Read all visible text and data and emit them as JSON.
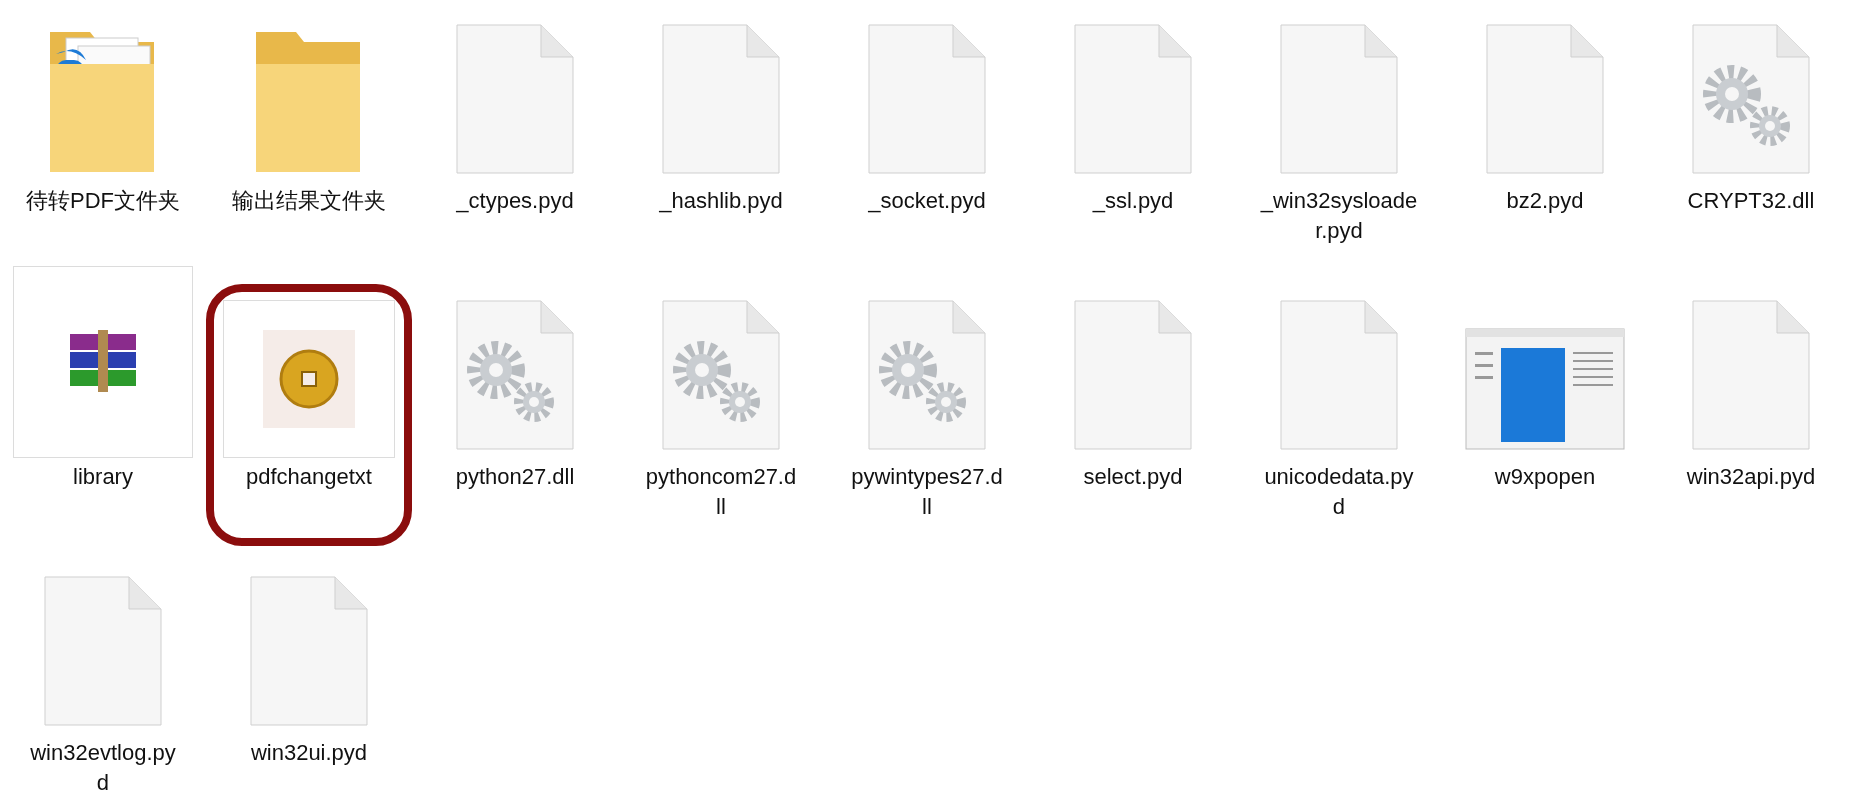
{
  "files": [
    {
      "kind": "folder-pdf",
      "label": [
        "待转PDF文件夹"
      ],
      "annotated": false
    },
    {
      "kind": "folder",
      "label": [
        "输出结果文件夹"
      ],
      "annotated": false
    },
    {
      "kind": "blank",
      "label": [
        "_ctypes.pyd"
      ],
      "annotated": false
    },
    {
      "kind": "blank",
      "label": [
        "_hashlib.pyd"
      ],
      "annotated": false
    },
    {
      "kind": "blank",
      "label": [
        "_socket.pyd"
      ],
      "annotated": false
    },
    {
      "kind": "blank",
      "label": [
        "_ssl.pyd"
      ],
      "annotated": false
    },
    {
      "kind": "blank",
      "label": [
        "_win32sysloade",
        "r.pyd"
      ],
      "annotated": false
    },
    {
      "kind": "blank",
      "label": [
        "bz2.pyd"
      ],
      "annotated": false
    },
    {
      "kind": "gears",
      "label": [
        "CRYPT32.dll"
      ],
      "annotated": false
    },
    {
      "kind": "archive",
      "label": [
        "library"
      ],
      "annotated": false
    },
    {
      "kind": "coin",
      "label": [
        "pdfchangetxt"
      ],
      "annotated": true
    },
    {
      "kind": "gears",
      "label": [
        "python27.dll"
      ],
      "annotated": false
    },
    {
      "kind": "gears",
      "label": [
        "pythoncom27.d",
        "ll"
      ],
      "annotated": false
    },
    {
      "kind": "gears",
      "label": [
        "pywintypes27.d",
        "ll"
      ],
      "annotated": false
    },
    {
      "kind": "blank",
      "label": [
        "select.pyd"
      ],
      "annotated": false
    },
    {
      "kind": "blank",
      "label": [
        "unicodedata.py",
        "d"
      ],
      "annotated": false
    },
    {
      "kind": "window",
      "label": [
        "w9xpopen"
      ],
      "annotated": false
    },
    {
      "kind": "blank",
      "label": [
        "win32api.pyd"
      ],
      "annotated": false
    },
    {
      "kind": "blank",
      "label": [
        "win32evtlog.py",
        "d"
      ],
      "annotated": false
    },
    {
      "kind": "blank",
      "label": [
        "win32ui.pyd"
      ],
      "annotated": false
    }
  ]
}
